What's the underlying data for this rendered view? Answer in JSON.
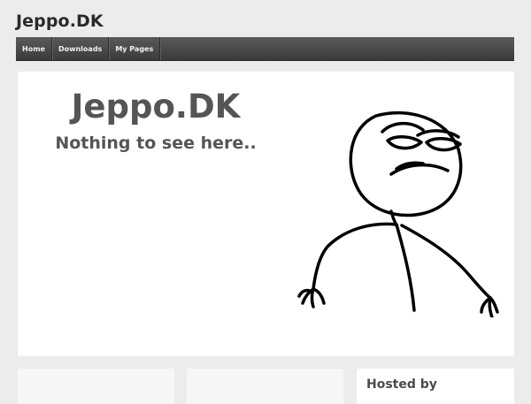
{
  "site": {
    "title": "Jeppo.DK"
  },
  "nav": {
    "items": [
      {
        "label": "Home"
      },
      {
        "label": "Downloads"
      },
      {
        "label": "My Pages"
      }
    ]
  },
  "hero": {
    "title": "Jeppo.DK",
    "subtitle": "Nothing to see here.."
  },
  "widgets": {
    "hosted_by_title": "Hosted by"
  }
}
